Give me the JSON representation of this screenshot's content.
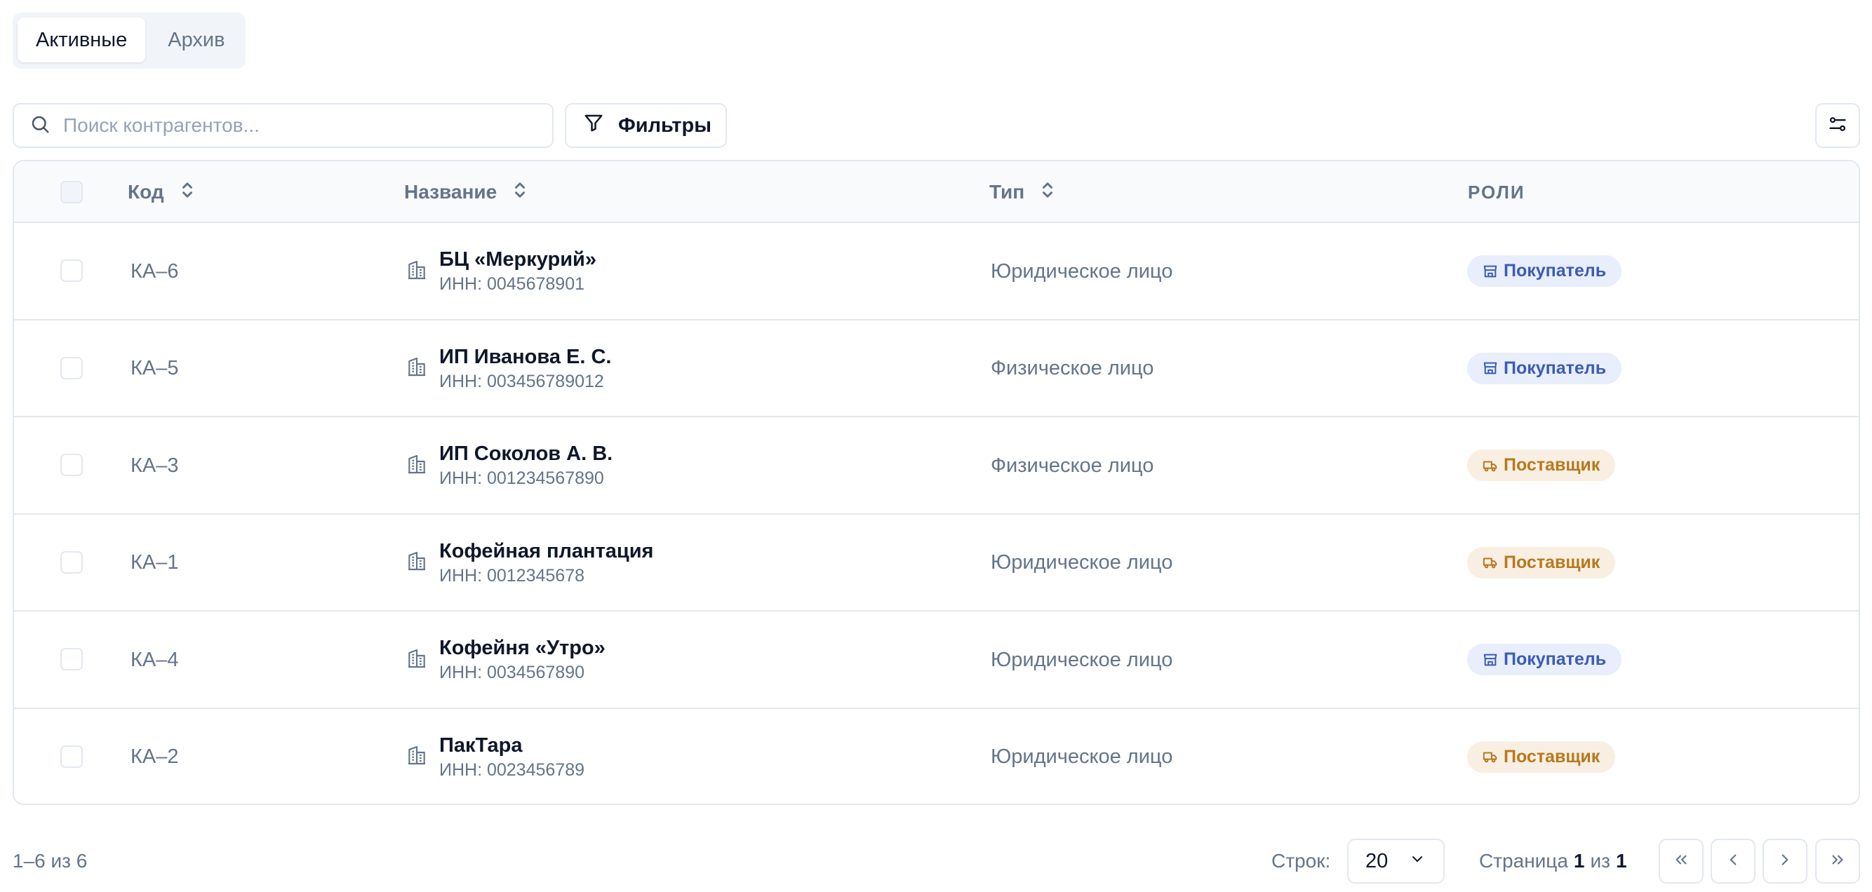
{
  "tabs": [
    {
      "label": "Активные",
      "active": true
    },
    {
      "label": "Архив",
      "active": false
    }
  ],
  "search": {
    "placeholder": "Поиск контрагентов...",
    "value": "",
    "icon": "search-icon"
  },
  "toolbar": {
    "filters_label": "Фильтры",
    "filter_icon": "filter-icon",
    "settings_icon": "settings-sliders-icon"
  },
  "table": {
    "columns": [
      {
        "label": "Код",
        "sortable": true
      },
      {
        "label": "Название",
        "sortable": true
      },
      {
        "label": "Тип",
        "sortable": true
      },
      {
        "label": "РОЛИ",
        "sortable": false
      }
    ],
    "rows": [
      {
        "code": "КА–6",
        "name": "БЦ «Меркурий»",
        "inn": "ИНН: 0045678901",
        "type": "Юридическое лицо",
        "role": "Покупатель",
        "role_kind": "buyer"
      },
      {
        "code": "КА–5",
        "name": "ИП Иванова Е. С.",
        "inn": "ИНН: 003456789012",
        "type": "Физическое лицо",
        "role": "Покупатель",
        "role_kind": "buyer"
      },
      {
        "code": "КА–3",
        "name": "ИП Соколов А. В.",
        "inn": "ИНН: 001234567890",
        "type": "Физическое лицо",
        "role": "Поставщик",
        "role_kind": "supplier"
      },
      {
        "code": "КА–1",
        "name": "Кофейная плантация",
        "inn": "ИНН: 0012345678",
        "type": "Юридическое лицо",
        "role": "Поставщик",
        "role_kind": "supplier"
      },
      {
        "code": "КА–4",
        "name": "Кофейня «Утро»",
        "inn": "ИНН: 0034567890",
        "type": "Юридическое лицо",
        "role": "Покупатель",
        "role_kind": "buyer"
      },
      {
        "code": "КА–2",
        "name": "ПакТара",
        "inn": "ИНН: 0023456789",
        "type": "Юридическое лицо",
        "role": "Поставщик",
        "role_kind": "supplier"
      }
    ]
  },
  "footer": {
    "count_text": "1–6 из 6",
    "rows_label": "Строк:",
    "rows_value": "20",
    "page_label": "Страница",
    "page_current": "1",
    "page_of": "из",
    "page_total": "1"
  },
  "colors": {
    "buyer": "#3b5bb5",
    "supplier": "#b7791f",
    "border": "#e2e8f0",
    "muted": "#64748b"
  }
}
